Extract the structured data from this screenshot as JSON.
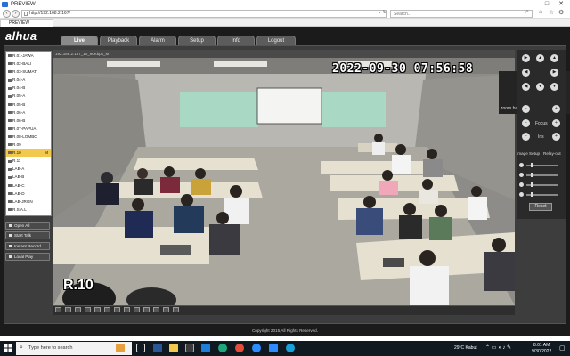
{
  "browser": {
    "title": "PREVIEW",
    "url": "http://192.168.2.167/",
    "search_placeholder": "Search...",
    "tab_label": "PREVIEW",
    "back_icon": "back-arrow-icon",
    "forward_icon": "forward-arrow-icon"
  },
  "app": {
    "logo": "alhua",
    "tabs": [
      "Live",
      "Playback",
      "Alarm",
      "Setup",
      "Info",
      "Logout"
    ],
    "active_tab": "Live",
    "channels": [
      {
        "label": "R.01-JAWA",
        "mark": ""
      },
      {
        "label": "R.02-BALI",
        "mark": ""
      },
      {
        "label": "R.03-SUMAT",
        "mark": ""
      },
      {
        "label": "R.04-A",
        "mark": ""
      },
      {
        "label": "R.04-B",
        "mark": ""
      },
      {
        "label": "R.05-A",
        "mark": ""
      },
      {
        "label": "R.05-B",
        "mark": ""
      },
      {
        "label": "R.06-A",
        "mark": ""
      },
      {
        "label": "R.06-B",
        "mark": ""
      },
      {
        "label": "R.07-PAPUA",
        "mark": ""
      },
      {
        "label": "R.08-LOMBC",
        "mark": ""
      },
      {
        "label": "R.09",
        "mark": ""
      },
      {
        "label": "R.10",
        "mark": "M"
      },
      {
        "label": "R.11",
        "mark": ""
      },
      {
        "label": "LAB-A",
        "mark": ""
      },
      {
        "label": "LAB-B",
        "mark": ""
      },
      {
        "label": "LAB-C",
        "mark": ""
      },
      {
        "label": "LAB-D",
        "mark": ""
      },
      {
        "label": "LAB-JRGN",
        "mark": ""
      },
      {
        "label": "R.S.A.L",
        "mark": ""
      }
    ],
    "selected_channel": "R.10",
    "left_buttons": [
      "Open All",
      "Start Talk",
      "Instant Record",
      "Local Play"
    ],
    "video_header": "192.168.2.167_10_90Kbps_M",
    "timestamp": "2022-09-30  07:56:58",
    "camera_label": "R.10",
    "zoom_tile": {
      "initial": "Z",
      "name": "zoom baa04"
    },
    "ptz": {
      "focus_label": "Focus",
      "iris_label": "Iris"
    },
    "image_setup_label": "Image Setup",
    "relay_out_label": "Relay-out",
    "reset_label": "Reset",
    "copyright": "Copyright 2015,All Rights Reserved."
  },
  "taskbar": {
    "search_placeholder": "Type here to search",
    "weather": "29°C  Kabut",
    "time": "8:01 AM",
    "date": "9/30/2022"
  },
  "colors": {
    "app_bg": "#1b1b1b",
    "panel_bg": "#3d3d3d",
    "selected_channel": "#f2c94c",
    "zoom_avatar": "#1f6fb0",
    "taskbar": "#101820"
  }
}
